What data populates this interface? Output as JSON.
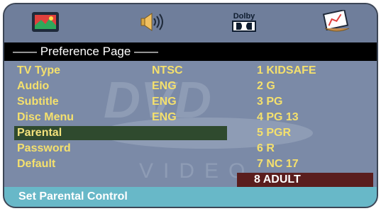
{
  "topbar": {
    "icons": [
      {
        "name": "tv-screen-icon"
      },
      {
        "name": "speaker-sound-icon"
      },
      {
        "name": "dolby-audio-icon",
        "label": "Dolby"
      },
      {
        "name": "preference-chart-icon"
      }
    ]
  },
  "page": {
    "title": "—— Preference Page ——"
  },
  "menu": {
    "items": [
      {
        "label": "TV Type",
        "value": "NTSC"
      },
      {
        "label": "Audio",
        "value": "ENG"
      },
      {
        "label": "Subtitle",
        "value": "ENG"
      },
      {
        "label": "Disc Menu",
        "value": "ENG"
      },
      {
        "label": "Parental"
      },
      {
        "label": "Password"
      },
      {
        "label": "Default"
      }
    ],
    "selected_index": 4
  },
  "options": {
    "items": [
      "1 KIDSAFE",
      "2 G",
      "3 PG",
      "4 PG 13",
      "5 PGR",
      "6 R",
      "7 NC 17",
      "8 ADULT"
    ],
    "selected_index": 7
  },
  "status": {
    "text": "Set Parental Control"
  },
  "colors": {
    "frame": "#6f7e9b",
    "panel": "#7b8aa7",
    "text_yellow": "#f4e06d",
    "status": "#68b8c8",
    "selected_left": "#2f4a2e",
    "selected_right": "#5a1d1d"
  }
}
